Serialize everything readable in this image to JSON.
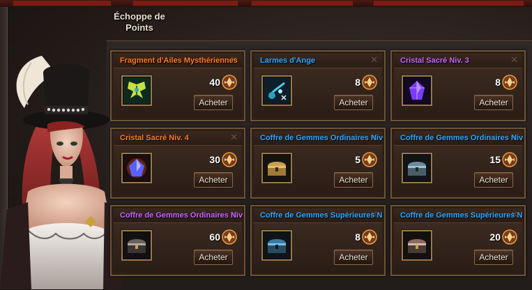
{
  "shop": {
    "title_line1": "Échoppe de",
    "title_line2": "Points"
  },
  "colors": {
    "orange": "#ff7a1e",
    "blue": "#2fa7ff",
    "purple": "#c865ff"
  },
  "items": [
    {
      "name": "Fragment d'Ailes Mysthériennes",
      "price": "40",
      "button": "Acheter",
      "color": "#ff7a1e",
      "icon": "wings-fragment-icon"
    },
    {
      "name": "Larmes d'Ange",
      "price": "8",
      "button": "Acheter",
      "color": "#2fa7ff",
      "icon": "angel-tears-icon"
    },
    {
      "name": "Cristal Sacré Niv. 3",
      "price": "8",
      "button": "Acheter",
      "color": "#c865ff",
      "icon": "purple-crystal-icon"
    },
    {
      "name": "Cristal Sacré Niv. 4",
      "price": "30",
      "button": "Acheter",
      "color": "#ff7a1e",
      "icon": "blue-crystal-icon"
    },
    {
      "name": "Coffre de Gemmes Ordinaires Niv",
      "price": "5",
      "button": "Acheter",
      "color": "#2fa7ff",
      "icon": "gold-chest-icon"
    },
    {
      "name": "Coffre de Gemmes Ordinaires Niv",
      "price": "15",
      "button": "Acheter",
      "color": "#2fa7ff",
      "icon": "silver-chest-icon"
    },
    {
      "name": "Coffre de Gemmes Ordinaires Niv",
      "price": "60",
      "button": "Acheter",
      "color": "#c865ff",
      "icon": "dark-chest-icon"
    },
    {
      "name": "Coffre de Gemmes Supérieures N",
      "price": "8",
      "button": "Acheter",
      "color": "#2fa7ff",
      "icon": "blue-chest-icon"
    },
    {
      "name": "Coffre de Gemmes Supérieures N",
      "price": "20",
      "button": "Acheter",
      "color": "#2fa7ff",
      "icon": "ornate-chest-icon"
    }
  ]
}
